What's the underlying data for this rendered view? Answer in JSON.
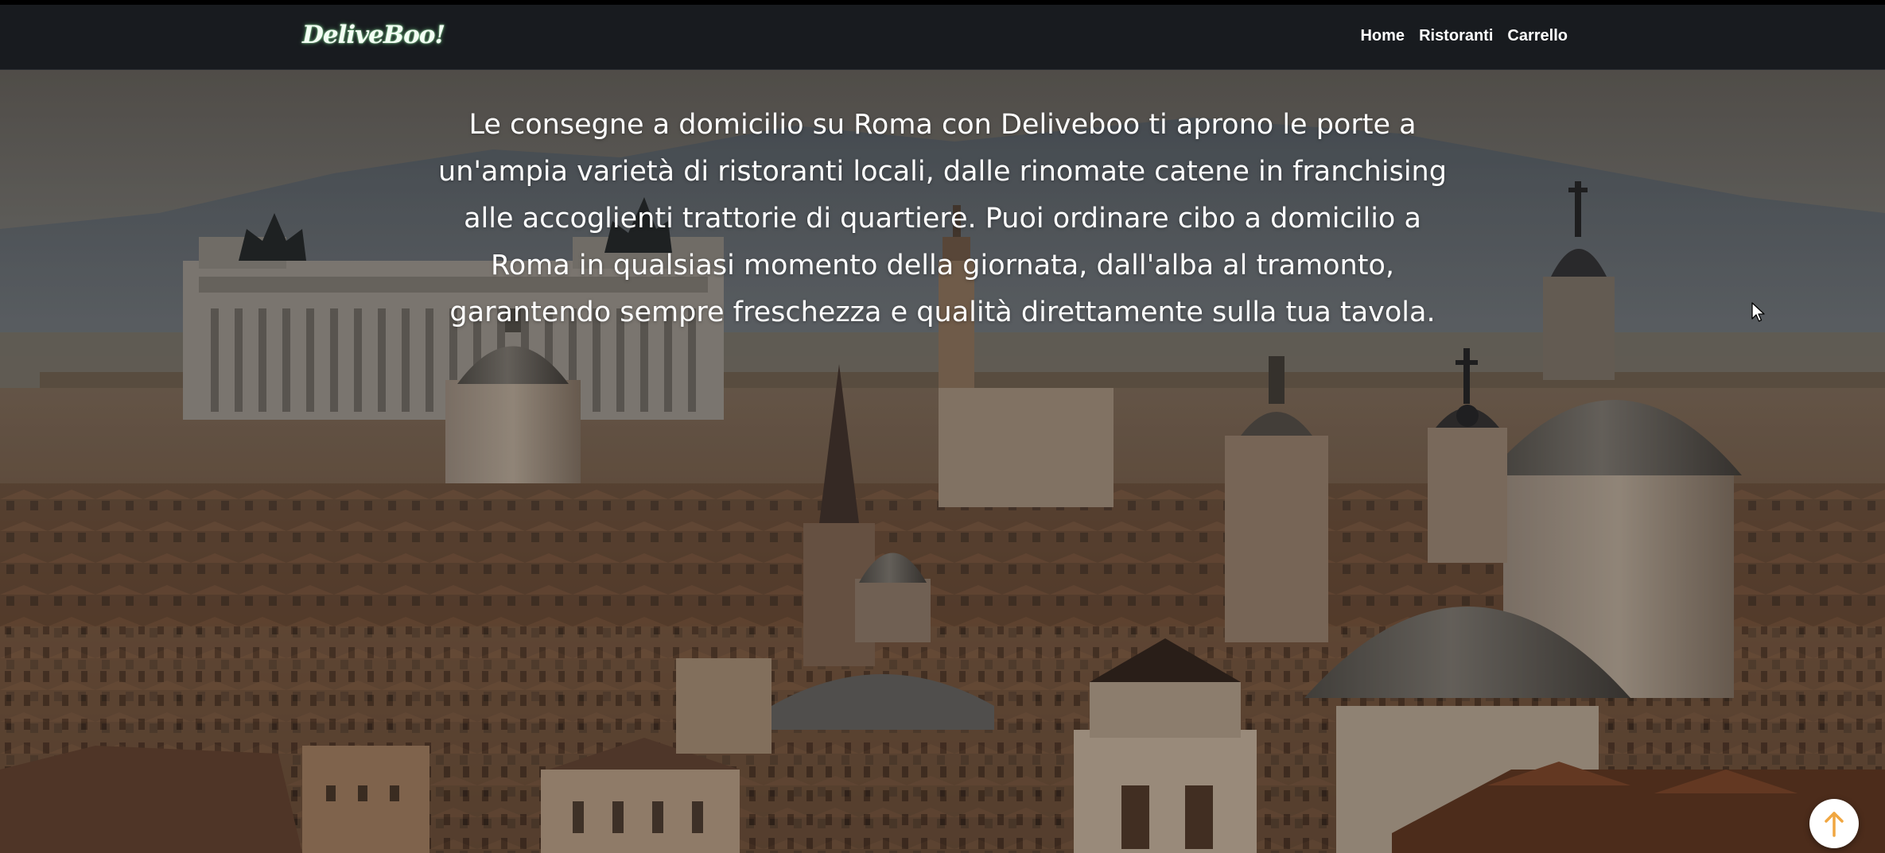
{
  "navbar": {
    "brand": "DeliveBoo!",
    "links": [
      {
        "label": "Home"
      },
      {
        "label": "Ristoranti"
      },
      {
        "label": "Carrello"
      }
    ]
  },
  "hero": {
    "background": "rome-skyline-photo",
    "text": "Le consegne a domicilio su Roma con Deliveboo ti aprono le porte a un'ampia varietà di ristoranti locali, dalle rinomate catene in franchising alle accoglienti trattorie di quartiere. Puoi ordinare cibo a domicilio a Roma in qualsiasi momento della giornata, dall'alba al tramonto, garantendo sempre freschezza e qualità direttamente sulla tua tavola."
  },
  "scroll_top": {
    "icon": "arrow-up-icon",
    "accent": "#f0a640"
  },
  "colors": {
    "navbar_bg": "#181b1f",
    "text": "#ffffff",
    "brand_glow": "#9be7a7"
  }
}
